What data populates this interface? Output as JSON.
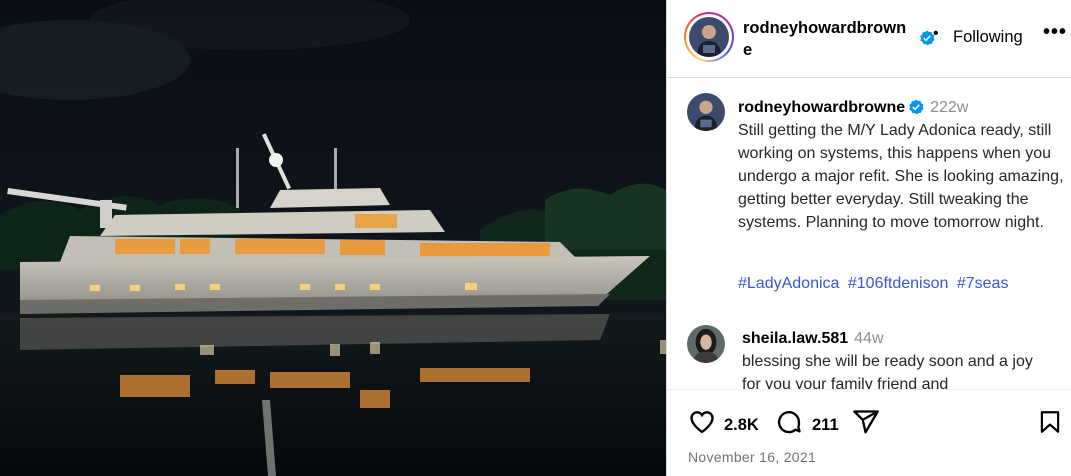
{
  "post": {
    "author": "rodneyhowardbrowne",
    "follow_label": "Following",
    "more_label": "•••",
    "dot": "•"
  },
  "caption": {
    "username": "rodneyhowardbrowne",
    "time": "222w",
    "text": "Still getting the M/Y Lady Adonica ready, still working on systems, this happens when you undergo a major refit. She is looking amazing, getting better everyday. Still tweaking the systems. Planning to move tomorrow night.",
    "hashtags": [
      "#LadyAdonica",
      "#106ftdenison",
      "#7seas"
    ]
  },
  "comment": {
    "username": "sheila.law.581",
    "time": "44w",
    "text": "blessing she will be ready soon and a joy for you your family friend and"
  },
  "actions": {
    "likes": "2.8K",
    "comments": "211"
  },
  "date": "November 16, 2021",
  "colors": {
    "verified": "#0095f6",
    "hashtag": "#3a56d4",
    "muted": "#8e8e8e"
  },
  "icons": [
    "verified-badge-icon",
    "heart-icon",
    "comment-icon",
    "share-icon",
    "bookmark-icon"
  ]
}
